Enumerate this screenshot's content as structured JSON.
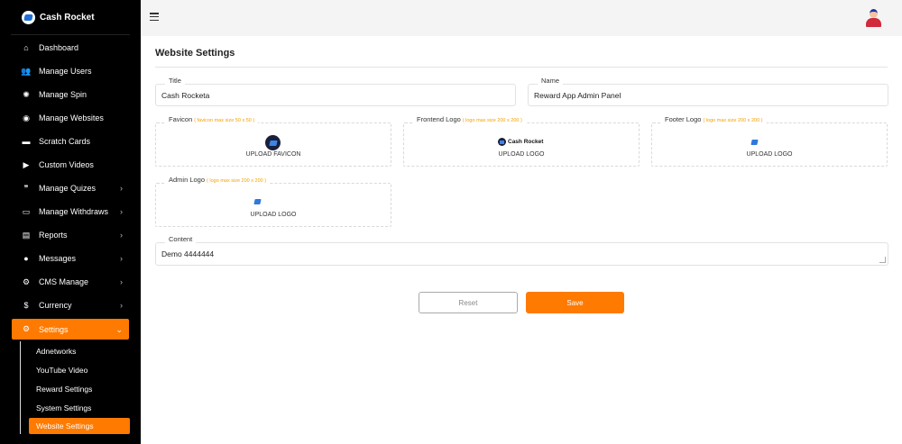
{
  "brand": {
    "name": "Cash Rocket"
  },
  "sidebar": {
    "items": [
      {
        "label": "Dashboard",
        "icon": "home-icon",
        "glyph": "⌂",
        "chevron": false
      },
      {
        "label": "Manage Users",
        "icon": "users-icon",
        "glyph": "👥",
        "chevron": false
      },
      {
        "label": "Manage Spin",
        "icon": "spinner-icon",
        "glyph": "✺",
        "chevron": false
      },
      {
        "label": "Manage Websites",
        "icon": "globe-icon",
        "glyph": "◉",
        "chevron": false
      },
      {
        "label": "Scratch Cards",
        "icon": "card-icon",
        "glyph": "▬",
        "chevron": false
      },
      {
        "label": "Custom Videos",
        "icon": "play-icon",
        "glyph": "▶",
        "chevron": false
      },
      {
        "label": "Manage Quizes",
        "icon": "quote-icon",
        "glyph": "❞",
        "chevron": true
      },
      {
        "label": "Manage Withdraws",
        "icon": "credit-card-icon",
        "glyph": "▭",
        "chevron": true
      },
      {
        "label": "Reports",
        "icon": "report-icon",
        "glyph": "▤",
        "chevron": true
      },
      {
        "label": "Messages",
        "icon": "chat-icon",
        "glyph": "●",
        "chevron": true
      },
      {
        "label": "CMS Manage",
        "icon": "cogs-icon",
        "glyph": "⚙",
        "chevron": true
      },
      {
        "label": "Currency",
        "icon": "currency-icon",
        "glyph": "$",
        "chevron": true
      }
    ],
    "active": {
      "label": "Settings",
      "icon": "cogs-icon",
      "glyph": "⚙"
    },
    "sub_items": [
      "Adnetworks",
      "YouTube Video",
      "Reward Settings",
      "System Settings"
    ],
    "active_sub": "Website Settings"
  },
  "page": {
    "title": "Website Settings"
  },
  "form": {
    "title": {
      "label": "Title",
      "value": "Cash Rocketa"
    },
    "name": {
      "label": "Name",
      "value": "Reward App Admin Panel"
    },
    "favicon": {
      "label": "Favicon",
      "hint": "( favicon max size 50 x 50 )",
      "action": "UPLOAD FAVICON"
    },
    "frontend_logo": {
      "label": "Frontend Logo",
      "hint": "( logo max size 200 x 200 )",
      "action": "UPLOAD LOGO",
      "logo_text": "Cash Rocket"
    },
    "footer_logo": {
      "label": "Footer Logo",
      "hint": "( logo max size 200 x 200 )",
      "action": "UPLOAD LOGO"
    },
    "admin_logo": {
      "label": "Admin Logo",
      "hint": "( logo max size 200 x 200 )",
      "action": "UPLOAD LOGO"
    },
    "content": {
      "label": "Content",
      "value": "Demo 4444444"
    }
  },
  "buttons": {
    "reset": "Reset",
    "save": "Save"
  },
  "colors": {
    "accent": "#ff7a00",
    "sidebar_bg": "#000000",
    "hint": "#f5a000"
  }
}
